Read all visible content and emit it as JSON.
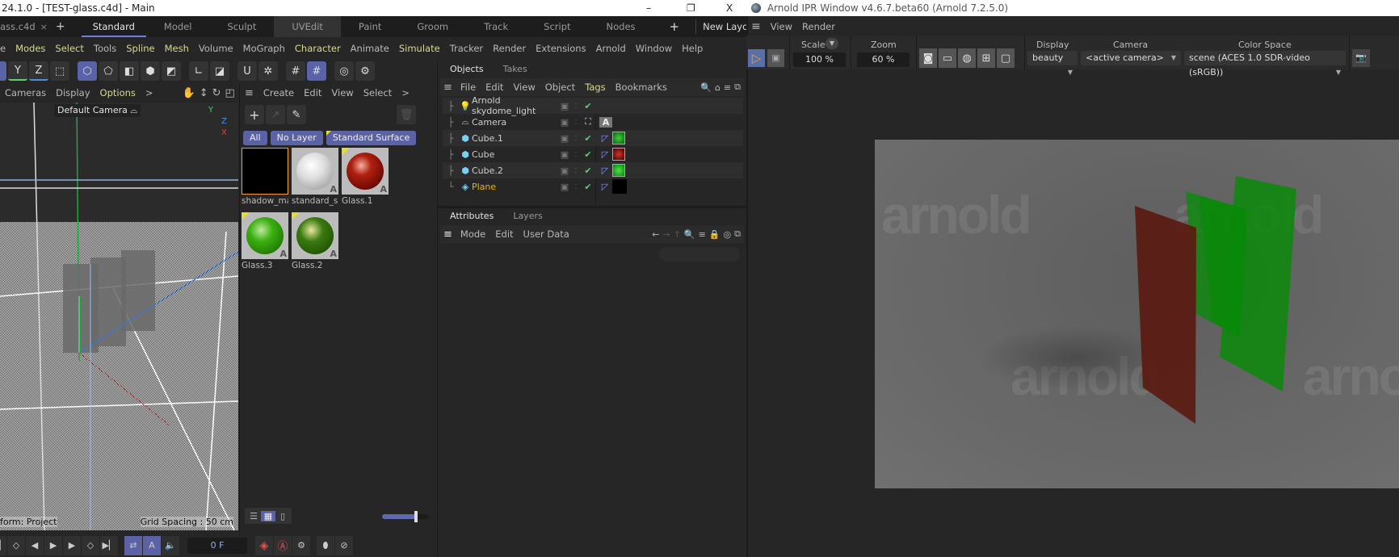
{
  "main_window": {
    "title": "24.1.0 - [TEST-glass.c4d] - Main",
    "controls": {
      "minimize": "–",
      "restore": "❐",
      "close": "X"
    },
    "doc_tab": {
      "label": "ass.c4d",
      "close": "×",
      "add": "+"
    },
    "layout_tabs": [
      "Standard",
      "Model",
      "Sculpt",
      "UVEdit",
      "Paint",
      "Groom",
      "Track",
      "Script",
      "Nodes"
    ],
    "active_layout": "Standard",
    "add_layout": "+",
    "new_layouts_label": "New Layouts",
    "menu": [
      "e",
      "Modes",
      "Select",
      "Tools",
      "Spline",
      "Mesh",
      "Volume",
      "MoGraph",
      "Character",
      "Animate",
      "Simulate",
      "Tracker",
      "Render",
      "Extensions",
      "Arnold",
      "Window",
      "Help"
    ],
    "toolbar_axis": [
      "Y",
      "Z"
    ]
  },
  "viewport": {
    "menu": [
      "Cameras",
      "Display",
      "Options",
      ">"
    ],
    "camera_label": "Default Camera",
    "axis": {
      "y": "Y",
      "z": "Z",
      "x": "X"
    },
    "status_left": "form: Project",
    "status_right": "Grid Spacing : 50 cm"
  },
  "material_manager": {
    "menu": [
      "Create",
      "Edit",
      "View",
      "Select",
      ">"
    ],
    "filters": [
      "All",
      "No Layer",
      "Standard Surface"
    ],
    "materials": [
      {
        "name": "shadow_ma",
        "type": "black"
      },
      {
        "name": "standard_su",
        "type": "white"
      },
      {
        "name": "Glass.1",
        "type": "red"
      },
      {
        "name": "Glass.3",
        "type": "green"
      },
      {
        "name": "Glass.2",
        "type": "darkgreen"
      }
    ],
    "arnold_mark": "A",
    "slider_value": 0.75
  },
  "objects": {
    "tabs": [
      "Objects",
      "Takes"
    ],
    "menu": [
      "File",
      "Edit",
      "View",
      "Object",
      "Tags",
      "Bookmarks"
    ],
    "rows": [
      {
        "name": "Arnold skydome_light",
        "icon": "light-bulb"
      },
      {
        "name": "Camera",
        "icon": "camera"
      },
      {
        "name": "Cube.1",
        "icon": "cube",
        "mat": "green"
      },
      {
        "name": "Cube",
        "icon": "cube",
        "mat": "red"
      },
      {
        "name": "Cube.2",
        "icon": "cube",
        "mat": "green"
      },
      {
        "name": "Plane",
        "icon": "plane",
        "mat": "black"
      }
    ],
    "camera_tag": "A"
  },
  "attributes": {
    "tabs": [
      "Attributes",
      "Layers"
    ],
    "menu": [
      "Mode",
      "Edit",
      "User Data"
    ]
  },
  "timeline": {
    "frame": "0 F"
  },
  "ipr": {
    "title": "Arnold IPR Window v4.6.7.beta60 (Arnold 7.2.5.0)",
    "menu": [
      "View",
      "Render"
    ],
    "scale_label": "Scale",
    "scale_value": "100 %",
    "zoom_label": "Zoom",
    "zoom_value": "60 %",
    "display_label": "Display",
    "display_value": "beauty",
    "camera_label": "Camera",
    "camera_value": "<active camera>",
    "colorspace_label": "Color Space",
    "colorspace_value": "scene (ACES 1.0 SDR-video (sRGB))",
    "watermark": "arnold"
  },
  "colors": {
    "accent": "#5b62a6",
    "play": "#f0a030",
    "check": "#5ad26e",
    "plane": "#f0b400"
  }
}
